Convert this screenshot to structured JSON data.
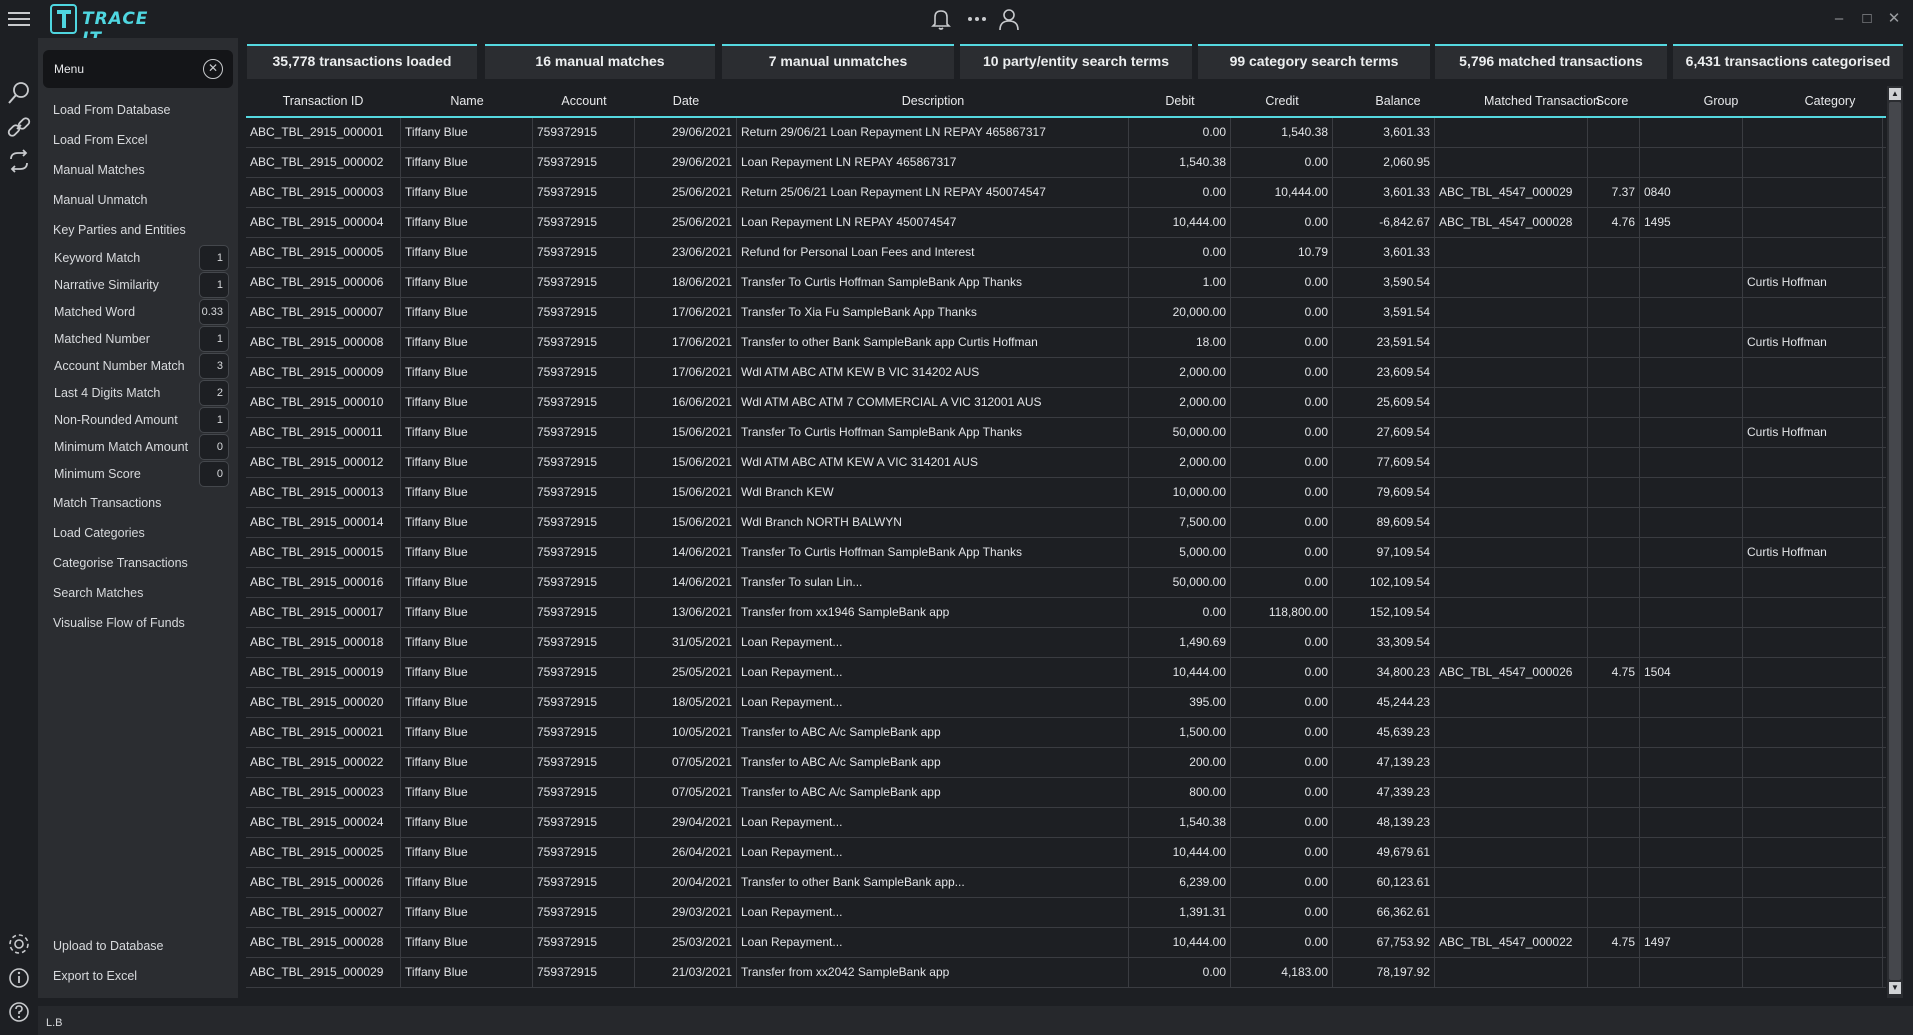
{
  "app": {
    "logo_text": "TRACE IT",
    "brand_color": "#4fd6e0",
    "accent_color": "#55d8e0"
  },
  "icons": {
    "notification": "bell-icon",
    "more": "more-dots-icon",
    "user": "user-icon",
    "search": "search-icon",
    "link": "link-icon",
    "refresh": "refresh-icon",
    "settings": "gear-icon",
    "info": "info-icon",
    "help": "help-icon"
  },
  "sidebar": {
    "menu_label": "Menu",
    "top_items": [
      "Load From Database",
      "Load From Excel",
      "Manual Matches",
      "Manual Unmatch",
      "Key Parties and Entities"
    ],
    "params": [
      {
        "label": "Keyword Match",
        "value": "1"
      },
      {
        "label": "Narrative Similarity",
        "value": "1"
      },
      {
        "label": "Matched Word",
        "value": "0.33"
      },
      {
        "label": "Matched Number",
        "value": "1"
      },
      {
        "label": "Account Number Match",
        "value": "3"
      },
      {
        "label": "Last 4 Digits Match",
        "value": "2"
      },
      {
        "label": "Non-Rounded Amount",
        "value": "1"
      },
      {
        "label": "Minimum Match Amount",
        "value": "0"
      },
      {
        "label": "Minimum Score",
        "value": "0"
      }
    ],
    "bottom_items": [
      "Match Transactions",
      "Load Categories",
      "Categorise Transactions",
      "Search Matches",
      "Visualise Flow of Funds"
    ],
    "footer_items": [
      "Upload to Database",
      "Export to Excel"
    ]
  },
  "stats": [
    "35,778 transactions loaded",
    "16 manual matches",
    "7 manual unmatches",
    "10 party/entity search terms",
    "99 category search terms",
    "5,796 matched transactions",
    "6,431 transactions categorised"
  ],
  "table": {
    "columns": [
      "Transaction ID",
      "Name",
      "Account",
      "Date",
      "Description",
      "Debit",
      "Credit",
      "Balance",
      "Matched Transaction",
      "Score",
      "Group",
      "Category"
    ],
    "rows": [
      [
        "ABC_TBL_2915_000001",
        "Tiffany Blue",
        "759372915",
        "29/06/2021",
        "Return 29/06/21 Loan Repayment LN REPAY 465867317",
        "0.00",
        "1,540.38",
        "3,601.33",
        "",
        "",
        "",
        ""
      ],
      [
        "ABC_TBL_2915_000002",
        "Tiffany Blue",
        "759372915",
        "29/06/2021",
        "Loan Repayment LN REPAY 465867317",
        "1,540.38",
        "0.00",
        "2,060.95",
        "",
        "",
        "",
        ""
      ],
      [
        "ABC_TBL_2915_000003",
        "Tiffany Blue",
        "759372915",
        "25/06/2021",
        "Return 25/06/21 Loan Repayment LN REPAY 450074547",
        "0.00",
        "10,444.00",
        "3,601.33",
        "ABC_TBL_4547_000029",
        "7.37",
        "0840",
        ""
      ],
      [
        "ABC_TBL_2915_000004",
        "Tiffany Blue",
        "759372915",
        "25/06/2021",
        "Loan Repayment LN REPAY 450074547",
        "10,444.00",
        "0.00",
        "-6,842.67",
        "ABC_TBL_4547_000028",
        "4.76",
        "1495",
        ""
      ],
      [
        "ABC_TBL_2915_000005",
        "Tiffany Blue",
        "759372915",
        "23/06/2021",
        "Refund for Personal Loan Fees and Interest",
        "0.00",
        "10.79",
        "3,601.33",
        "",
        "",
        "",
        ""
      ],
      [
        "ABC_TBL_2915_000006",
        "Tiffany Blue",
        "759372915",
        "18/06/2021",
        "Transfer To Curtis Hoffman SampleBank App Thanks",
        "1.00",
        "0.00",
        "3,590.54",
        "",
        "",
        "",
        "Curtis Hoffman"
      ],
      [
        "ABC_TBL_2915_000007",
        "Tiffany Blue",
        "759372915",
        "17/06/2021",
        "Transfer To Xia Fu SampleBank App Thanks",
        "20,000.00",
        "0.00",
        "3,591.54",
        "",
        "",
        "",
        ""
      ],
      [
        "ABC_TBL_2915_000008",
        "Tiffany Blue",
        "759372915",
        "17/06/2021",
        "Transfer to other Bank SampleBank app Curtis Hoffman",
        "18.00",
        "0.00",
        "23,591.54",
        "",
        "",
        "",
        "Curtis Hoffman"
      ],
      [
        "ABC_TBL_2915_000009",
        "Tiffany Blue",
        "759372915",
        "17/06/2021",
        "Wdl ATM ABC ATM KEW B    VIC 314202 AUS",
        "2,000.00",
        "0.00",
        "23,609.54",
        "",
        "",
        "",
        ""
      ],
      [
        "ABC_TBL_2915_000010",
        "Tiffany Blue",
        "759372915",
        "16/06/2021",
        "Wdl ATM ABC ATM 7 COMMERCIAL A VIC 312001 AUS",
        "2,000.00",
        "0.00",
        "25,609.54",
        "",
        "",
        "",
        ""
      ],
      [
        "ABC_TBL_2915_000011",
        "Tiffany Blue",
        "759372915",
        "15/06/2021",
        "Transfer To Curtis Hoffman SampleBank App Thanks",
        "50,000.00",
        "0.00",
        "27,609.54",
        "",
        "",
        "",
        "Curtis Hoffman"
      ],
      [
        "ABC_TBL_2915_000012",
        "Tiffany Blue",
        "759372915",
        "15/06/2021",
        "Wdl ATM ABC ATM KEW A    VIC 314201 AUS",
        "2,000.00",
        "0.00",
        "77,609.54",
        "",
        "",
        "",
        ""
      ],
      [
        "ABC_TBL_2915_000013",
        "Tiffany Blue",
        "759372915",
        "15/06/2021",
        "Wdl Branch KEW",
        "10,000.00",
        "0.00",
        "79,609.54",
        "",
        "",
        "",
        ""
      ],
      [
        "ABC_TBL_2915_000014",
        "Tiffany Blue",
        "759372915",
        "15/06/2021",
        "Wdl Branch NORTH BALWYN",
        "7,500.00",
        "0.00",
        "89,609.54",
        "",
        "",
        "",
        ""
      ],
      [
        "ABC_TBL_2915_000015",
        "Tiffany Blue",
        "759372915",
        "14/06/2021",
        "Transfer To Curtis Hoffman SampleBank App Thanks",
        "5,000.00",
        "0.00",
        "97,109.54",
        "",
        "",
        "",
        "Curtis Hoffman"
      ],
      [
        "ABC_TBL_2915_000016",
        "Tiffany Blue",
        "759372915",
        "14/06/2021",
        "Transfer To sulan Lin...",
        "50,000.00",
        "0.00",
        "102,109.54",
        "",
        "",
        "",
        ""
      ],
      [
        "ABC_TBL_2915_000017",
        "Tiffany Blue",
        "759372915",
        "13/06/2021",
        "Transfer from xx1946 SampleBank app",
        "0.00",
        "118,800.00",
        "152,109.54",
        "",
        "",
        "",
        ""
      ],
      [
        "ABC_TBL_2915_000018",
        "Tiffany Blue",
        "759372915",
        "31/05/2021",
        "Loan Repayment...",
        "1,490.69",
        "0.00",
        "33,309.54",
        "",
        "",
        "",
        ""
      ],
      [
        "ABC_TBL_2915_000019",
        "Tiffany Blue",
        "759372915",
        "25/05/2021",
        "Loan Repayment...",
        "10,444.00",
        "0.00",
        "34,800.23",
        "ABC_TBL_4547_000026",
        "4.75",
        "1504",
        ""
      ],
      [
        "ABC_TBL_2915_000020",
        "Tiffany Blue",
        "759372915",
        "18/05/2021",
        "Loan Repayment...",
        "395.00",
        "0.00",
        "45,244.23",
        "",
        "",
        "",
        ""
      ],
      [
        "ABC_TBL_2915_000021",
        "Tiffany Blue",
        "759372915",
        "10/05/2021",
        "Transfer to ABC A/c SampleBank app",
        "1,500.00",
        "0.00",
        "45,639.23",
        "",
        "",
        "",
        ""
      ],
      [
        "ABC_TBL_2915_000022",
        "Tiffany Blue",
        "759372915",
        "07/05/2021",
        "Transfer to ABC A/c SampleBank app",
        "200.00",
        "0.00",
        "47,139.23",
        "",
        "",
        "",
        ""
      ],
      [
        "ABC_TBL_2915_000023",
        "Tiffany Blue",
        "759372915",
        "07/05/2021",
        "Transfer to ABC A/c SampleBank app",
        "800.00",
        "0.00",
        "47,339.23",
        "",
        "",
        "",
        ""
      ],
      [
        "ABC_TBL_2915_000024",
        "Tiffany Blue",
        "759372915",
        "29/04/2021",
        "Loan Repayment...",
        "1,540.38",
        "0.00",
        "48,139.23",
        "",
        "",
        "",
        ""
      ],
      [
        "ABC_TBL_2915_000025",
        "Tiffany Blue",
        "759372915",
        "26/04/2021",
        "Loan Repayment...",
        "10,444.00",
        "0.00",
        "49,679.61",
        "",
        "",
        "",
        ""
      ],
      [
        "ABC_TBL_2915_000026",
        "Tiffany Blue",
        "759372915",
        "20/04/2021",
        "Transfer to other Bank SampleBank app...",
        "6,239.00",
        "0.00",
        "60,123.61",
        "",
        "",
        "",
        ""
      ],
      [
        "ABC_TBL_2915_000027",
        "Tiffany Blue",
        "759372915",
        "29/03/2021",
        "Loan Repayment...",
        "1,391.31",
        "0.00",
        "66,362.61",
        "",
        "",
        "",
        ""
      ],
      [
        "ABC_TBL_2915_000028",
        "Tiffany Blue",
        "759372915",
        "25/03/2021",
        "Loan Repayment...",
        "10,444.00",
        "0.00",
        "67,753.92",
        "ABC_TBL_4547_000022",
        "4.75",
        "1497",
        ""
      ],
      [
        "ABC_TBL_2915_000029",
        "Tiffany Blue",
        "759372915",
        "21/03/2021",
        "Transfer from xx2042 SampleBank app",
        "0.00",
        "4,183.00",
        "78,197.92",
        "",
        "",
        "",
        ""
      ]
    ]
  },
  "status_text": "L.B"
}
